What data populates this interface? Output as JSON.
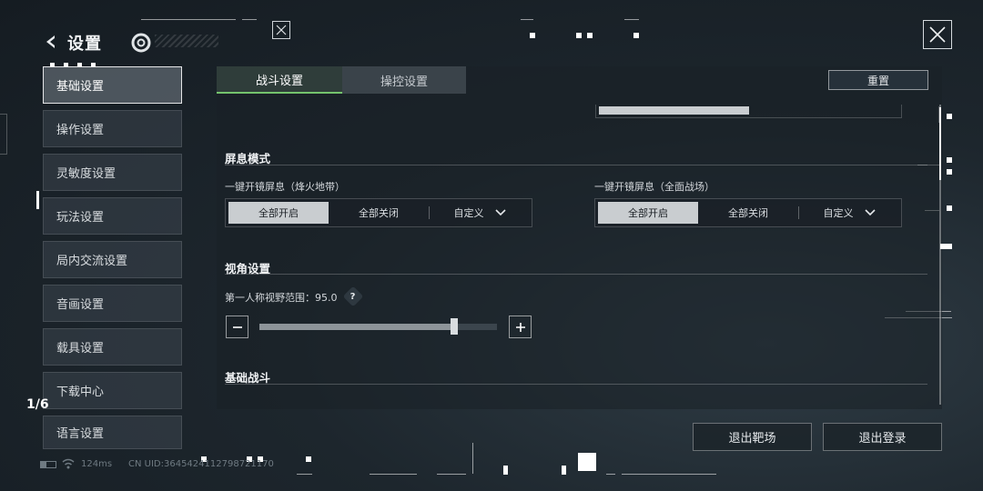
{
  "header": {
    "title": "设置"
  },
  "sidebar": {
    "items": [
      {
        "label": "基础设置",
        "active": true
      },
      {
        "label": "操作设置"
      },
      {
        "label": "灵敏度设置"
      },
      {
        "label": "玩法设置"
      },
      {
        "label": "局内交流设置"
      },
      {
        "label": "音画设置"
      },
      {
        "label": "载具设置"
      },
      {
        "label": "下载中心"
      },
      {
        "label": "语言设置"
      }
    ],
    "page_indicator": "1/6"
  },
  "tabs": [
    {
      "label": "战斗设置",
      "active": true
    },
    {
      "label": "操控设置"
    }
  ],
  "reset_label": "重置",
  "sections": {
    "breath": {
      "title": "屏息模式",
      "left": {
        "label": "一键开镜屏息（烽火地带）",
        "options": [
          "全部开启",
          "全部关闭",
          "自定义"
        ],
        "selected": "全部开启"
      },
      "right": {
        "label": "一键开镜屏息（全面战场）",
        "options": [
          "全部开启",
          "全部关闭",
          "自定义"
        ],
        "selected": "全部开启"
      }
    },
    "view": {
      "title": "视角设置",
      "fov_label": "第一人称视野范围：",
      "fov_value": "95.0",
      "fov_fraction": 0.82,
      "help": "?"
    },
    "combat": {
      "title": "基础战斗"
    }
  },
  "buttons": {
    "exit_range": "退出靶场",
    "logout": "退出登录"
  },
  "footer": {
    "ping": "124ms",
    "uid": "CN UID:3645424112798721170"
  },
  "icons": {
    "back": "back-arrow-icon",
    "close": "close-icon",
    "logo": "logo-icon",
    "chevron": "chevron-down-icon",
    "help": "help-icon",
    "minus": "minus-icon",
    "plus": "plus-icon",
    "battery": "battery-icon",
    "wifi": "wifi-icon"
  },
  "colors": {
    "accent": "#74c36d",
    "selected_option": "#c9cdd0"
  }
}
